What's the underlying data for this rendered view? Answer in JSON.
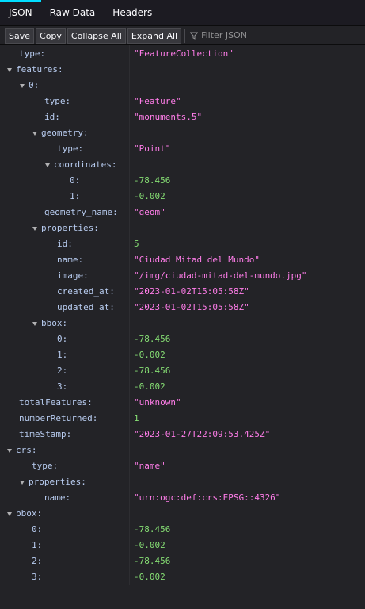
{
  "tabs": [
    "JSON",
    "Raw Data",
    "Headers"
  ],
  "toolbar": {
    "save": "Save",
    "copy": "Copy",
    "collapse_all": "Collapse All",
    "expand_all": "Expand All",
    "filter_placeholder": "Filter JSON"
  },
  "colors": {
    "key": "#b8ccf0",
    "string": "#ff7de9",
    "number": "#86de74",
    "accent": "#00ddff"
  },
  "rows": [
    {
      "depth": 1,
      "key": "type:",
      "value": "\"FeatureCollection\"",
      "kind": "str",
      "toggle": false
    },
    {
      "depth": 0,
      "key": "features:",
      "value": "",
      "kind": "",
      "toggle": true
    },
    {
      "depth": 1,
      "key": "0:",
      "value": "",
      "kind": "",
      "toggle": true
    },
    {
      "depth": 3,
      "key": "type:",
      "value": "\"Feature\"",
      "kind": "str",
      "toggle": false
    },
    {
      "depth": 3,
      "key": "id:",
      "value": "\"monuments.5\"",
      "kind": "str",
      "toggle": false
    },
    {
      "depth": 2,
      "key": "geometry:",
      "value": "",
      "kind": "",
      "toggle": true
    },
    {
      "depth": 4,
      "key": "type:",
      "value": "\"Point\"",
      "kind": "str",
      "toggle": false
    },
    {
      "depth": 3,
      "key": "coordinates:",
      "value": "",
      "kind": "",
      "toggle": true
    },
    {
      "depth": 5,
      "key": "0:",
      "value": "-78.456",
      "kind": "num",
      "toggle": false
    },
    {
      "depth": 5,
      "key": "1:",
      "value": "-0.002",
      "kind": "num",
      "toggle": false
    },
    {
      "depth": 3,
      "key": "geometry_name:",
      "value": "\"geom\"",
      "kind": "str",
      "toggle": false
    },
    {
      "depth": 2,
      "key": "properties:",
      "value": "",
      "kind": "",
      "toggle": true
    },
    {
      "depth": 4,
      "key": "id:",
      "value": "5",
      "kind": "num",
      "toggle": false
    },
    {
      "depth": 4,
      "key": "name:",
      "value": "\"Ciudad Mitad del Mundo\"",
      "kind": "str",
      "toggle": false
    },
    {
      "depth": 4,
      "key": "image:",
      "value": "\"/img/ciudad-mitad-del-mundo.jpg\"",
      "kind": "str",
      "toggle": false
    },
    {
      "depth": 4,
      "key": "created_at:",
      "value": "\"2023-01-02T15:05:58Z\"",
      "kind": "str",
      "toggle": false
    },
    {
      "depth": 4,
      "key": "updated_at:",
      "value": "\"2023-01-02T15:05:58Z\"",
      "kind": "str",
      "toggle": false
    },
    {
      "depth": 2,
      "key": "bbox:",
      "value": "",
      "kind": "",
      "toggle": true
    },
    {
      "depth": 4,
      "key": "0:",
      "value": "-78.456",
      "kind": "num",
      "toggle": false
    },
    {
      "depth": 4,
      "key": "1:",
      "value": "-0.002",
      "kind": "num",
      "toggle": false
    },
    {
      "depth": 4,
      "key": "2:",
      "value": "-78.456",
      "kind": "num",
      "toggle": false
    },
    {
      "depth": 4,
      "key": "3:",
      "value": "-0.002",
      "kind": "num",
      "toggle": false
    },
    {
      "depth": 1,
      "key": "totalFeatures:",
      "value": "\"unknown\"",
      "kind": "str",
      "toggle": false
    },
    {
      "depth": 1,
      "key": "numberReturned:",
      "value": "1",
      "kind": "num",
      "toggle": false
    },
    {
      "depth": 1,
      "key": "timeStamp:",
      "value": "\"2023-01-27T22:09:53.425Z\"",
      "kind": "str",
      "toggle": false
    },
    {
      "depth": 0,
      "key": "crs:",
      "value": "",
      "kind": "",
      "toggle": true
    },
    {
      "depth": 2,
      "key": "type:",
      "value": "\"name\"",
      "kind": "str",
      "toggle": false
    },
    {
      "depth": 1,
      "key": "properties:",
      "value": "",
      "kind": "",
      "toggle": true
    },
    {
      "depth": 3,
      "key": "name:",
      "value": "\"urn:ogc:def:crs:EPSG::4326\"",
      "kind": "str",
      "toggle": false
    },
    {
      "depth": 0,
      "key": "bbox:",
      "value": "",
      "kind": "",
      "toggle": true
    },
    {
      "depth": 2,
      "key": "0:",
      "value": "-78.456",
      "kind": "num",
      "toggle": false
    },
    {
      "depth": 2,
      "key": "1:",
      "value": "-0.002",
      "kind": "num",
      "toggle": false
    },
    {
      "depth": 2,
      "key": "2:",
      "value": "-78.456",
      "kind": "num",
      "toggle": false
    },
    {
      "depth": 2,
      "key": "3:",
      "value": "-0.002",
      "kind": "num",
      "toggle": false
    }
  ]
}
